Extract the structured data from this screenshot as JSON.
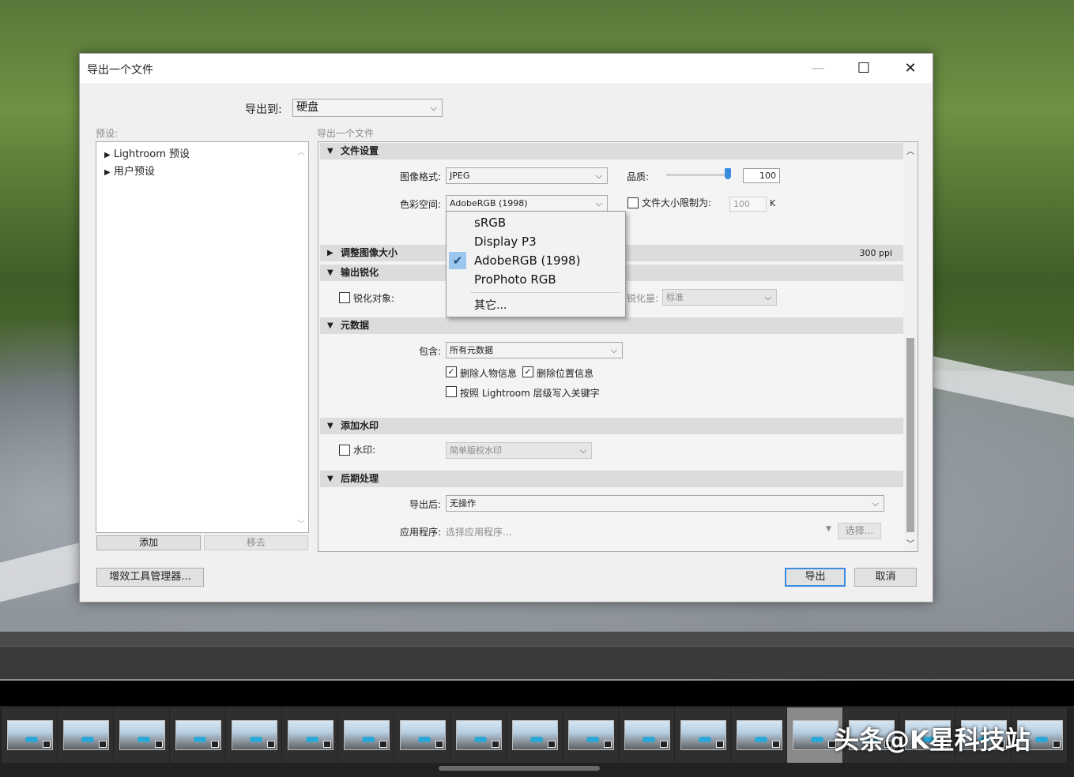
{
  "dialog": {
    "title": "导出一个文件",
    "export_to_label": "导出到:",
    "export_to_value": "硬盘",
    "preset_label": "预设:",
    "right_panel_label": "导出一个文件",
    "presets": [
      "Lightroom 预设",
      "用户预设"
    ],
    "add_button": "添加",
    "remove_button": "移去",
    "plugin_manager_button": "增效工具管理器...",
    "export_button": "导出",
    "cancel_button": "取消"
  },
  "file_settings": {
    "header": "文件设置",
    "format_label": "图像格式:",
    "format_value": "JPEG",
    "quality_label": "品质:",
    "quality_value": "100",
    "quality_level": 1.0,
    "colorspace_label": "色彩空间:",
    "colorspace_value": "AdobeRGB (1998)",
    "limit_label": "文件大小限制为:",
    "limit_value": "100",
    "limit_unit": "K"
  },
  "colorspace_menu": {
    "options": [
      "sRGB",
      "Display P3",
      "AdobeRGB (1998)",
      "ProPhoto RGB"
    ],
    "selected": "AdobeRGB (1998)",
    "other": "其它..."
  },
  "image_sizing": {
    "header": "调整图像大小",
    "resolution": "300 ppi"
  },
  "sharpening": {
    "header": "输出锐化",
    "sharpen_for_label": "锐化对象:",
    "amount_label": "锐化量:",
    "amount_value": "标准"
  },
  "metadata": {
    "header": "元数据",
    "include_label": "包含:",
    "include_value": "所有元数据",
    "remove_person": "删除人物信息",
    "remove_location": "删除位置信息",
    "hierarchy_keywords": "按照 Lightroom 层级写入关键字"
  },
  "watermark": {
    "header": "添加水印",
    "watermark_label": "水印:",
    "watermark_value": "简单版权水印"
  },
  "post_processing": {
    "header": "后期处理",
    "after_export_label": "导出后:",
    "after_export_value": "无操作",
    "application_label": "应用程序:",
    "application_placeholder": "选择应用程序...",
    "choose_button": "选择..."
  },
  "watermark_overlay": "头条@K星科技站",
  "colors": {
    "accent": "#3b8be0",
    "menu_check_bg": "#9cc8ef"
  }
}
